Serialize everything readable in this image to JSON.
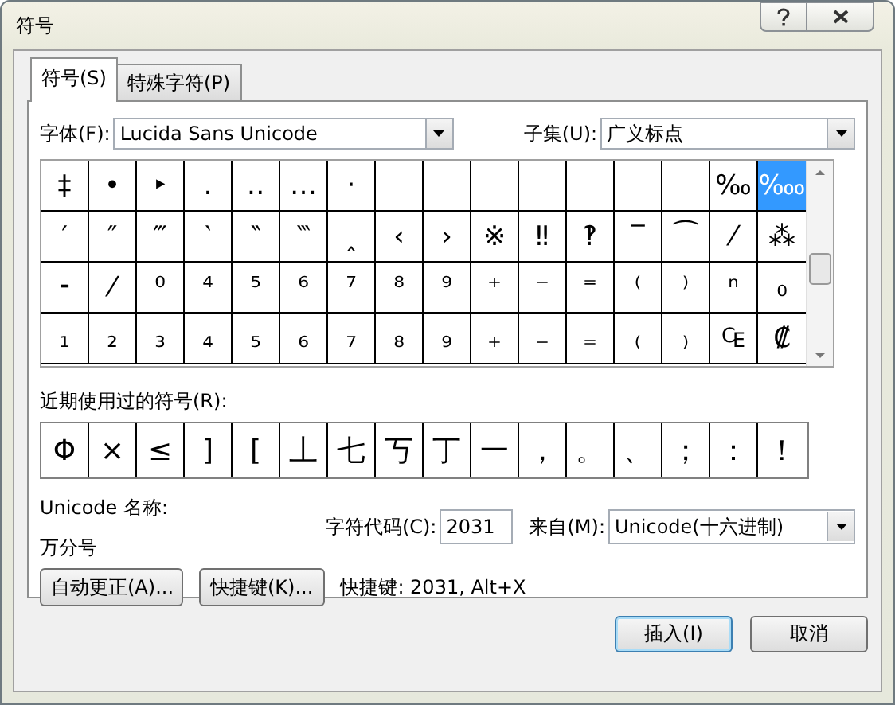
{
  "window": {
    "title": "符号"
  },
  "tabs": [
    {
      "label": "符号(S)",
      "selected": true
    },
    {
      "label": "特殊字符(P)",
      "selected": false
    }
  ],
  "font_field": {
    "label": "字体(F):",
    "value": "Lucida Sans Unicode"
  },
  "subset_field": {
    "label": "子集(U):",
    "value": "广义标点"
  },
  "symbol_grid": {
    "rows": [
      [
        {
          "char": "‡",
          "selected": false
        },
        {
          "char": "•",
          "selected": false
        },
        {
          "char": "‣",
          "selected": false
        },
        {
          "char": "․",
          "selected": false
        },
        {
          "char": "‥",
          "selected": false
        },
        {
          "char": "…",
          "selected": false
        },
        {
          "char": "‧",
          "selected": false
        },
        {
          "selected": false
        },
        {
          "selected": false
        },
        {
          "selected": false
        },
        {
          "selected": false
        },
        {
          "selected": false
        },
        {
          "selected": false
        },
        {
          "selected": false
        },
        {
          "char": "‰",
          "selected": false
        },
        {
          "char": "‱",
          "selected": true
        }
      ],
      [
        {
          "char": "′",
          "selected": false
        },
        {
          "char": "″",
          "selected": false
        },
        {
          "char": "‴",
          "selected": false
        },
        {
          "char": "‵",
          "selected": false
        },
        {
          "char": "‶",
          "selected": false
        },
        {
          "char": "‷",
          "selected": false
        },
        {
          "char": "‸",
          "selected": false
        },
        {
          "char": "‹",
          "selected": false
        },
        {
          "char": "›",
          "selected": false
        },
        {
          "char": "※",
          "selected": false
        },
        {
          "char": "‼",
          "selected": false
        },
        {
          "char": "‽",
          "selected": false
        },
        {
          "char": "‾",
          "selected": false
        },
        {
          "char": "⁀",
          "selected": false
        },
        {
          "char": "⁄",
          "selected": false
        },
        {
          "char": "⁂",
          "selected": false
        }
      ],
      [
        {
          "char": "⁃",
          "selected": false
        },
        {
          "char": "⁄",
          "selected": false
        },
        {
          "char": "⁰",
          "selected": false
        },
        {
          "char": "⁴",
          "selected": false
        },
        {
          "char": "⁵",
          "selected": false
        },
        {
          "char": "⁶",
          "selected": false
        },
        {
          "char": "⁷",
          "selected": false
        },
        {
          "char": "⁸",
          "selected": false
        },
        {
          "char": "⁹",
          "selected": false
        },
        {
          "char": "⁺",
          "selected": false
        },
        {
          "char": "⁻",
          "selected": false
        },
        {
          "char": "⁼",
          "selected": false
        },
        {
          "char": "⁽",
          "selected": false
        },
        {
          "char": "⁾",
          "selected": false
        },
        {
          "char": "ⁿ",
          "selected": false
        },
        {
          "char": "₀",
          "selected": false
        }
      ],
      [
        {
          "char": "₁",
          "selected": false
        },
        {
          "char": "₂",
          "selected": false
        },
        {
          "char": "₃",
          "selected": false
        },
        {
          "char": "₄",
          "selected": false
        },
        {
          "char": "₅",
          "selected": false
        },
        {
          "char": "₆",
          "selected": false
        },
        {
          "char": "₇",
          "selected": false
        },
        {
          "char": "₈",
          "selected": false
        },
        {
          "char": "₉",
          "selected": false
        },
        {
          "char": "₊",
          "selected": false
        },
        {
          "char": "₋",
          "selected": false
        },
        {
          "char": "₌",
          "selected": false
        },
        {
          "char": "₍",
          "selected": false
        },
        {
          "char": "₎",
          "selected": false
        },
        {
          "char": "₠",
          "selected": false
        },
        {
          "char": "₡",
          "selected": false
        }
      ]
    ]
  },
  "recent": {
    "label": "近期使用过的符号(R):",
    "symbols": [
      "Φ",
      "×",
      "≤",
      "]",
      "[",
      "丄",
      "七",
      "丂",
      "丁",
      "一",
      "，",
      "。",
      "、",
      "；",
      "：",
      "！"
    ]
  },
  "unicode_name": {
    "label": "Unicode 名称:",
    "value": "万分号"
  },
  "char_code": {
    "label": "字符代码(C):",
    "value": "2031"
  },
  "from_field": {
    "label": "来自(M):",
    "value": "Unicode(十六进制)"
  },
  "action_buttons": [
    {
      "label": "自动更正(A)..."
    },
    {
      "label": "快捷键(K)..."
    }
  ],
  "shortcut_text": "快捷键: 2031, Alt+X",
  "footer_buttons": [
    {
      "label": "插入(I)",
      "default": true
    },
    {
      "label": "取消",
      "default": false
    }
  ]
}
